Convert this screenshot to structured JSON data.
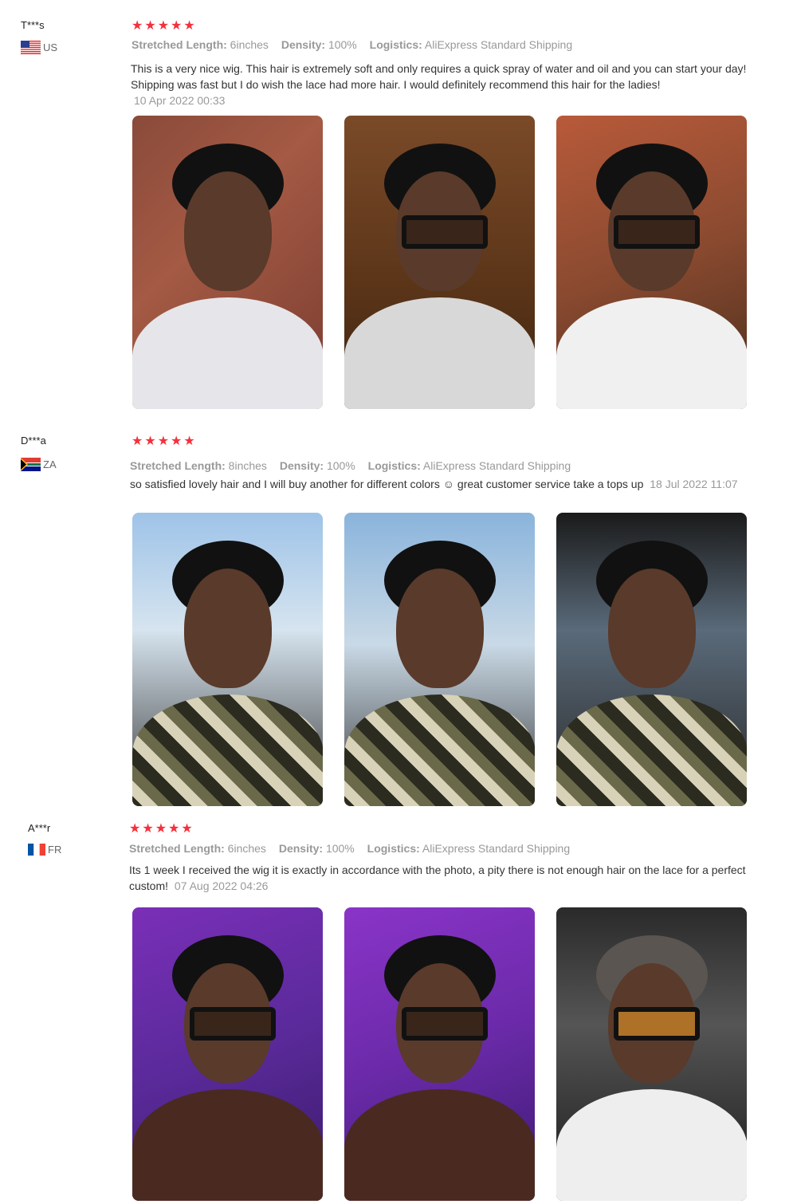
{
  "reviews": [
    {
      "user": "T***s",
      "country": "US",
      "rating": 5,
      "stretched_length_label": "Stretched Length:",
      "stretched_length": "6inches",
      "density_label": "Density:",
      "density": "100%",
      "logistics_label": "Logistics:",
      "logistics": "AliExpress Standard Shipping",
      "text": "This is a very nice wig. This hair is extremely soft and only requires a quick spray of water and oil and you can start your day! Shipping was fast but I do wish the lace had more hair. I would definitely recommend this hair for the ladies!",
      "date": "10 Apr 2022 00:33"
    },
    {
      "user": "D***a",
      "country": "ZA",
      "rating": 5,
      "stretched_length_label": "Stretched Length:",
      "stretched_length": "8inches",
      "density_label": "Density:",
      "density": "100%",
      "logistics_label": "Logistics:",
      "logistics": "AliExpress Standard Shipping",
      "text": "so satisfied lovely hair and I will buy another for different colors ☺ great customer service take a tops up",
      "date": "18 Jul 2022 11:07"
    },
    {
      "user": "A***r",
      "country": "FR",
      "rating": 5,
      "stretched_length_label": "Stretched Length:",
      "stretched_length": "6inches",
      "density_label": "Density:",
      "density": "100%",
      "logistics_label": "Logistics:",
      "logistics": "AliExpress Standard Shipping",
      "text": "Its 1 week I received the wig it is exactly in accordance with the photo, a pity there is not enough hair on the lace for a perfect custom!",
      "date": "07 Aug 2022 04:26"
    }
  ],
  "colors": {
    "star": "#f5303d",
    "meta": "#999999",
    "text": "#333333"
  }
}
